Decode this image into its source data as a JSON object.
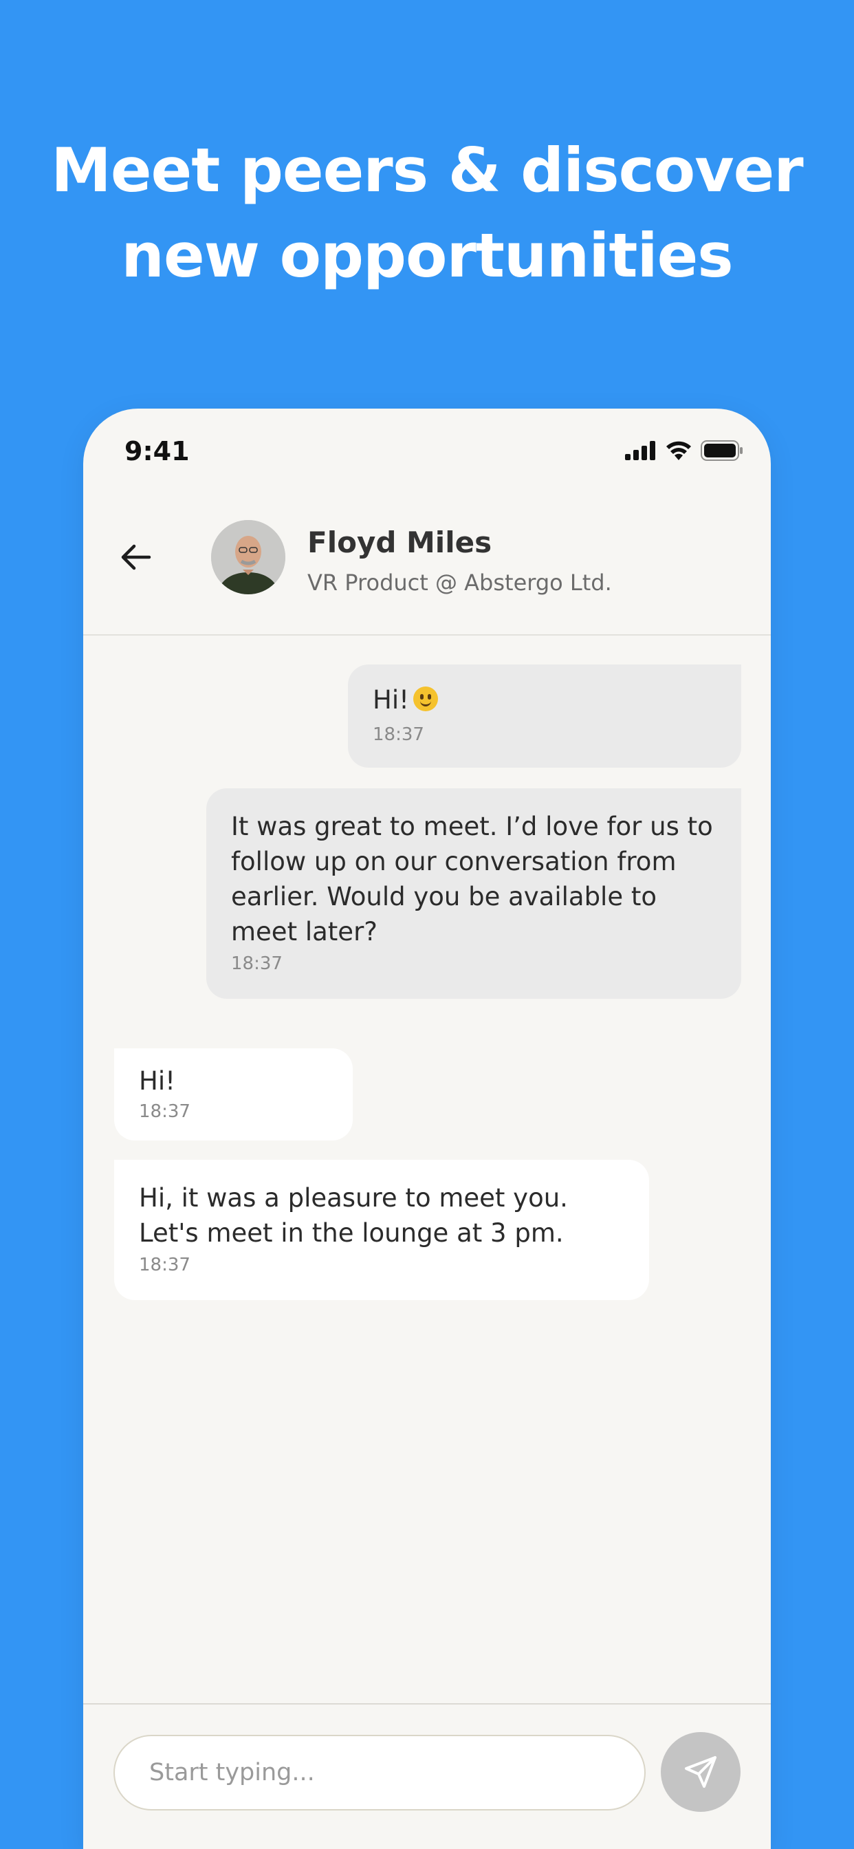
{
  "headline": {
    "line1": "Meet peers & discover",
    "line2": "new opportunities"
  },
  "status_bar": {
    "time": "9:41",
    "icons": [
      "cellular-signal-icon",
      "wifi-icon",
      "battery-icon"
    ]
  },
  "chat_header": {
    "back_icon": "arrow-left-icon",
    "contact_name": "Floyd Miles",
    "contact_role": "VR Product @ Abstergo Ltd."
  },
  "messages": [
    {
      "direction": "sent",
      "text": "Hi!",
      "emoji": "slightly-smiling-face",
      "time": "18:37"
    },
    {
      "direction": "sent",
      "text": "It was great to meet. I’d love for us to follow up on our conversation from earlier. Would you be available to meet later?",
      "time": "18:37"
    },
    {
      "direction": "received",
      "text": "Hi!",
      "time": "18:37"
    },
    {
      "direction": "received",
      "text": "Hi, it was a pleasure to meet you. Let's meet in the lounge at 3 pm.",
      "time": "18:37"
    }
  ],
  "composer": {
    "placeholder": "Start typing...",
    "value": "",
    "send_icon": "send-icon"
  },
  "colors": {
    "background": "#3395F4",
    "app_background": "#F7F6F3",
    "sent_bubble": "#EAEAEA",
    "received_bubble": "#FFFFFF",
    "send_button": "#C4C4C4"
  }
}
